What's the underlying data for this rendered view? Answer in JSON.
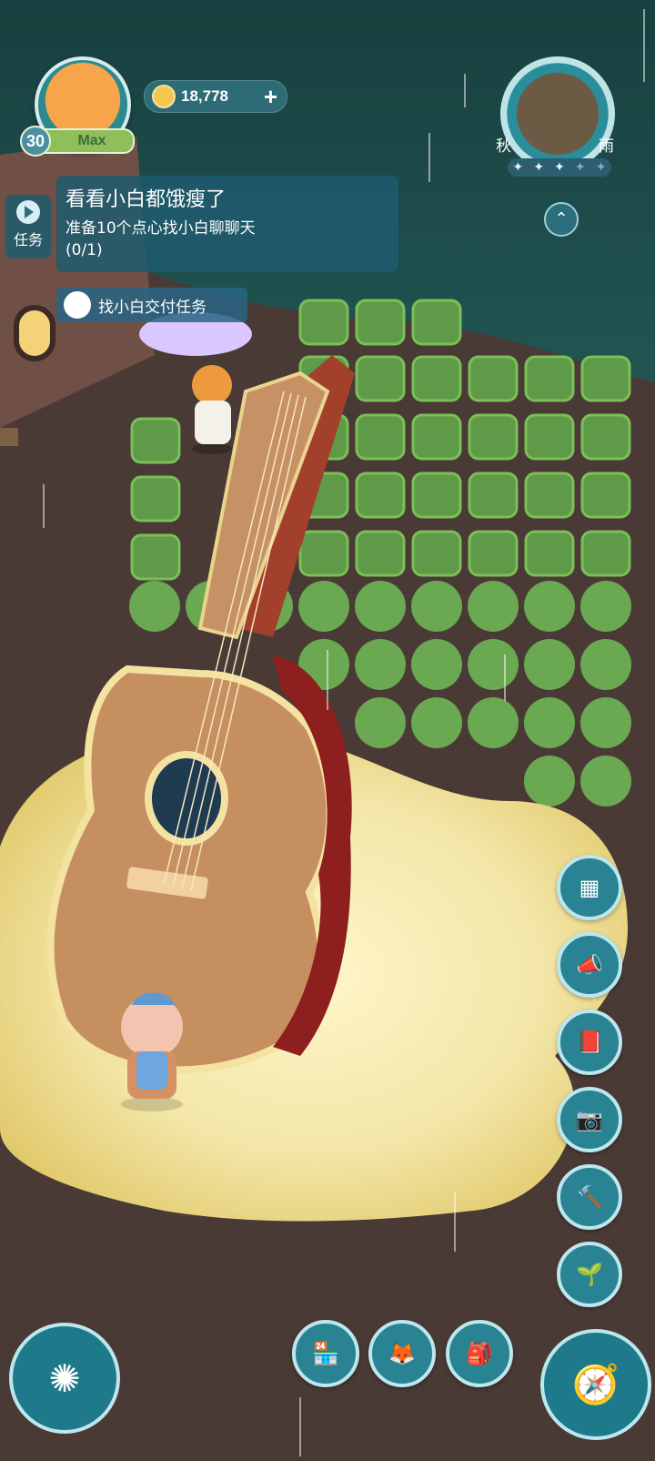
{
  "player": {
    "level": "30",
    "level_status": "Max",
    "coins": "18,778",
    "coin_add_label": "+",
    "avatar_icon": "fox-avatar-icon"
  },
  "task": {
    "tab_label": "任务",
    "title": "看看小白都饿瘦了",
    "description": "准备10个点心找小白聊聊天",
    "progress": "(0/1)",
    "hint": "找小白交付任务"
  },
  "weather": {
    "season": "秋",
    "condition": "雨",
    "stars": [
      "✦",
      "✦",
      "✦",
      "✦",
      "✦"
    ],
    "filled_stars": 3
  },
  "side_menu": [
    {
      "icon": "catalog-icon",
      "glyph": "▦"
    },
    {
      "icon": "announcement-icon",
      "glyph": "📣"
    },
    {
      "icon": "album-icon",
      "glyph": "📕"
    },
    {
      "icon": "camera-icon",
      "glyph": "📷"
    },
    {
      "icon": "hammer-icon",
      "glyph": "🔨"
    },
    {
      "icon": "sprout-icon",
      "glyph": "🌱"
    }
  ],
  "bottom_menu": [
    {
      "icon": "shop-icon",
      "glyph": "🏪"
    },
    {
      "icon": "fox-icon",
      "glyph": "🦊"
    },
    {
      "icon": "backpack-icon",
      "glyph": "🎒"
    }
  ],
  "corner_controls": {
    "left_icon": "magic-circle-icon",
    "left_glyph": "✺",
    "right_icon": "compass-icon",
    "right_glyph": "🧭"
  },
  "colors": {
    "night_green": "#1f4f4f",
    "sand": "#f1e3a5",
    "button_teal": "#2a8392"
  }
}
